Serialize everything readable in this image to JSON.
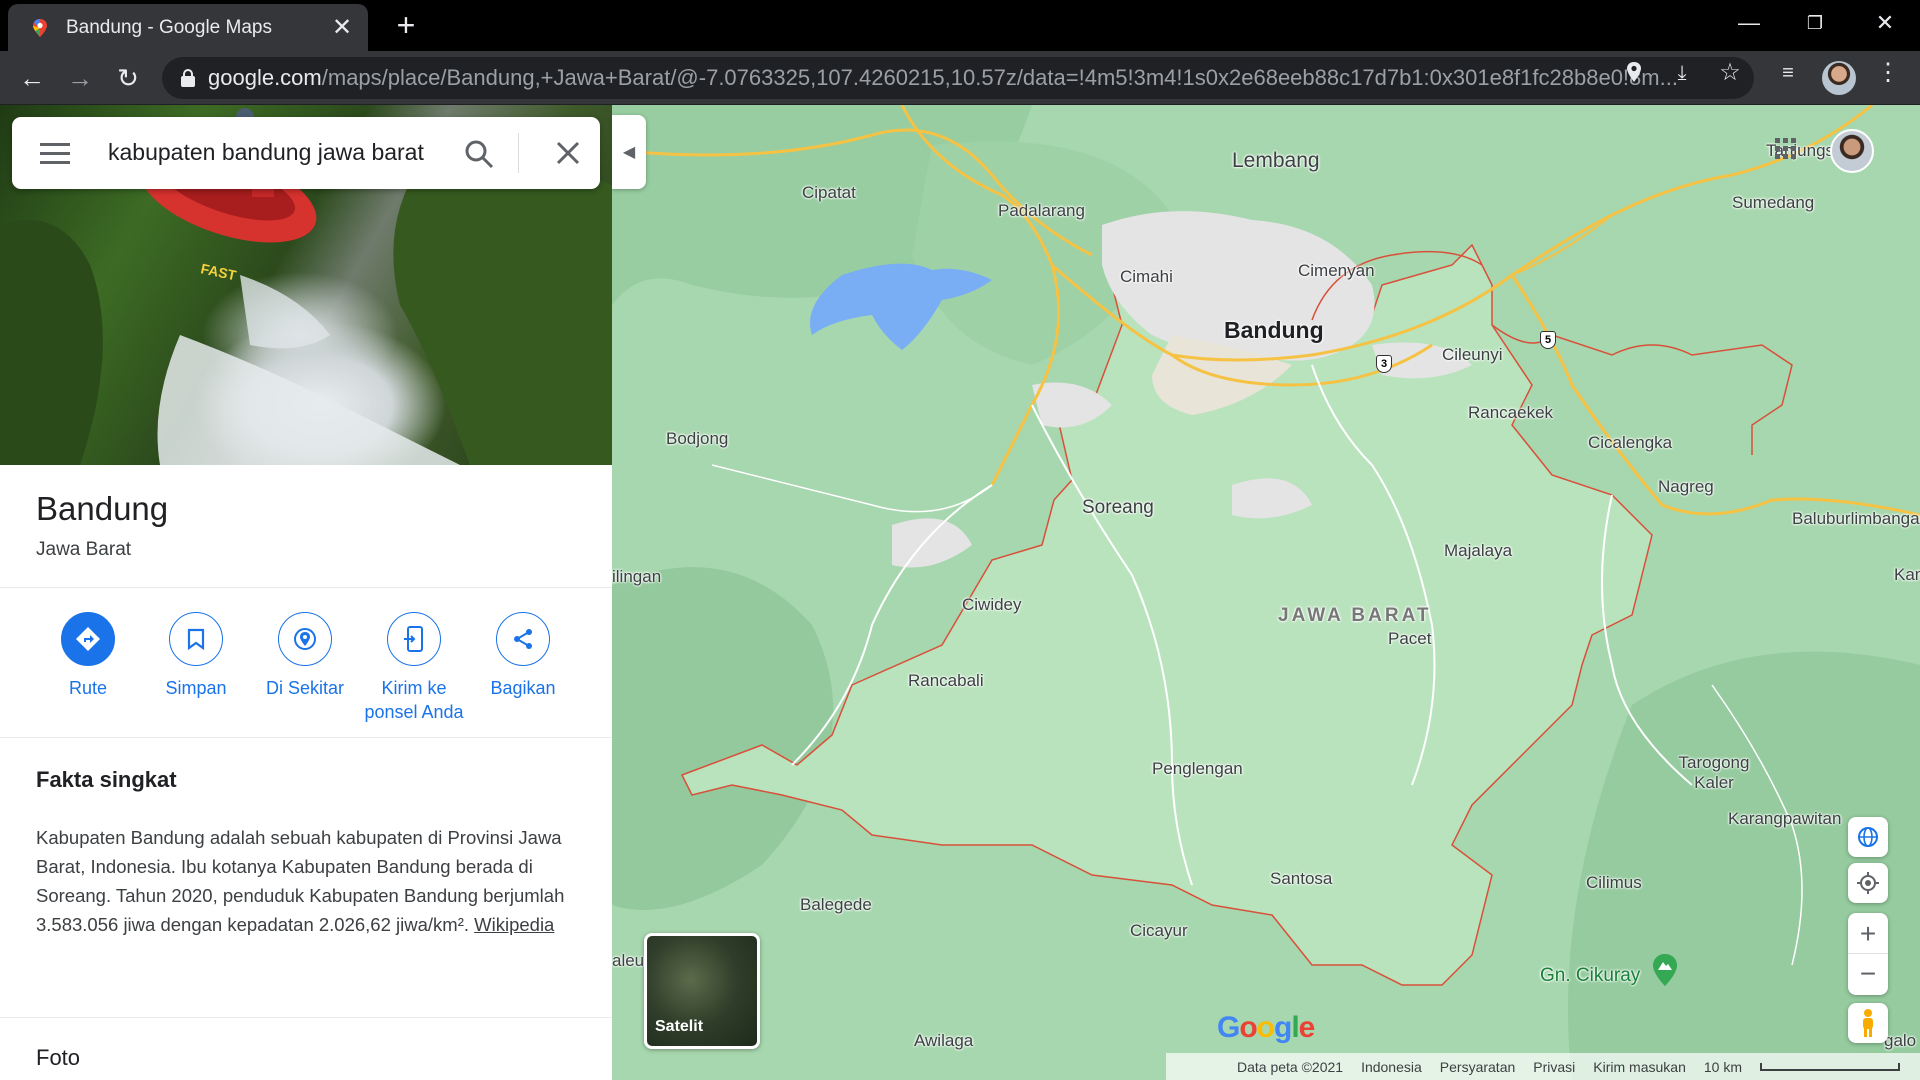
{
  "browser": {
    "tab_title": "Bandung - Google Maps",
    "url_host": "google.com",
    "url_path": "/maps/place/Bandung,+Jawa+Barat/@-7.0763325,107.4260215,10.57z/data=!4m5!3m4!1s0x2e68eeb88c17d7b1:0x301e8f1fc28b8e0!8m..."
  },
  "search": {
    "query": "kabupaten bandung jawa barat"
  },
  "place": {
    "title": "Bandung",
    "subtitle": "Jawa Barat"
  },
  "actions": [
    {
      "label": "Rute"
    },
    {
      "label": "Simpan"
    },
    {
      "label": "Di Sekitar"
    },
    {
      "label": "Kirim ke ponsel Anda"
    },
    {
      "label": "Bagikan"
    }
  ],
  "facts": {
    "title": "Fakta singkat",
    "text": "Kabupaten Bandung adalah sebuah kabupaten di Provinsi Jawa Barat, Indonesia. Ibu kotanya Kabupaten Bandung berada di Soreang. Tahun 2020, penduduk Kabupaten Bandung berjumlah 3.583.056 jiwa dengan kepadatan 2.026,62 jiwa/km².",
    "link": "Wikipedia"
  },
  "photos_title": "Foto",
  "map": {
    "labels": {
      "lembang": "Lembang",
      "cipatat": "Cipatat",
      "padalarang": "Padalarang",
      "cimahi": "Cimahi",
      "cimenyan": "Cimenyan",
      "bandung": "Bandung",
      "sumedang": "Sumedang",
      "tanjungsari": "Tanjungsari",
      "cileunyi": "Cileunyi",
      "rancaekek": "Rancaekek",
      "cicalengka": "Cicalengka",
      "nagreg": "Nagreg",
      "baluburlimbangan": "Baluburlimbangan",
      "kam": "Kam",
      "bodjong": "Bodjong",
      "soreang": "Soreang",
      "majalaya": "Majalaya",
      "cililin": "ilingan",
      "ciwidey": "Ciwidey",
      "jawa_barat": "JAWA BARAT",
      "pacet": "Pacet",
      "rancabali": "Rancabali",
      "penglengan": "Penglengan",
      "tarogong": "Tarogong Kaler",
      "karangpawitan": "Karangpawitan",
      "santosa": "Santosa",
      "cilimus": "Cilimus",
      "balegede": "Balegede",
      "cicayur": "Cicayur",
      "cikuray": "Gn. Cikuray",
      "awilaga": "Awilaga",
      "leu": "aleu",
      "galo": "galo"
    },
    "road_shields": [
      "3",
      "5"
    ],
    "satellite_label": "Satelit",
    "google_logo": "Google",
    "footer": {
      "data": "Data peta ©2021",
      "country": "Indonesia",
      "terms": "Persyaratan",
      "privacy": "Privasi",
      "feedback": "Kirim masukan",
      "scale": "10 km"
    }
  },
  "colors": {
    "accent": "#1a73e8",
    "map_green": "#a7d7ae",
    "boundary": "#d9503a",
    "road_yellow": "#f6c244"
  }
}
